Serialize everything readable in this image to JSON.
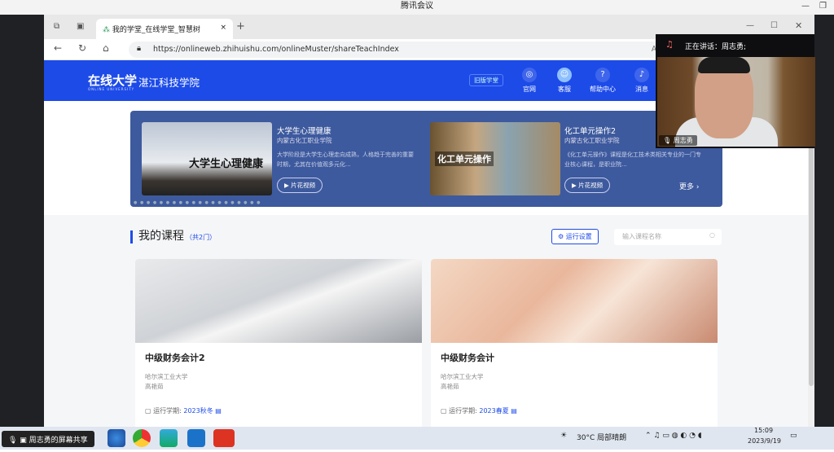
{
  "app": {
    "title": "腾讯会议"
  },
  "browser": {
    "tab_title": "我的学堂_在线学堂_智慧树",
    "tab_close": "×",
    "new_tab": "+",
    "url": "https://onlineweb.zhihuishu.com/onlineMuster/shareTeachIndex"
  },
  "header": {
    "logo": "在线大学",
    "logo_sub": "ONLINE UNIVERSITY",
    "school": "湛江科技学院",
    "old_btn": "旧版学堂",
    "nav": [
      {
        "label": "官网",
        "icon": "globe-icon"
      },
      {
        "label": "客服",
        "icon": "user-icon"
      },
      {
        "label": "帮助中心",
        "icon": "help-icon"
      },
      {
        "label": "消息",
        "icon": "bell-icon"
      }
    ]
  },
  "banner": {
    "items": [
      {
        "title": "大学生心理健康",
        "school": "内蒙古化工职业学院",
        "desc": "大学阶段是大学生心理走向成熟，人格趋于完善的重要时期，尤其在价值观多元化...",
        "btn": "▶ 片花视频",
        "img_text": "大学生心理健康"
      },
      {
        "title": "化工单元操作2",
        "school": "内蒙古化工职业学院",
        "desc": "《化工单元操作》课程是化工技术类相关专业的一门专业核心课程，是职业院...",
        "btn": "▶ 片花视频",
        "img_text": "化工单元操作"
      }
    ],
    "more": "更多 ›"
  },
  "courses": {
    "title": "我的课程",
    "count": "（共2门）",
    "settings_btn": "⚙ 运行设置",
    "search_placeholder": "输入课程名称",
    "items": [
      {
        "title": "中级财务会计2",
        "university": "哈尔滨工业大学",
        "teacher": "高艳茹",
        "term_label": "运行学期:",
        "term": "2023秋冬"
      },
      {
        "title": "中级财务会计",
        "university": "哈尔滨工业大学",
        "teacher": "高艳茹",
        "term_label": "运行学期:",
        "term": "2023春夏"
      }
    ]
  },
  "meeting": {
    "speaking": "正在讲话：周志勇;",
    "participant": "周志勇",
    "share_label": "周志勇的屏幕共享"
  },
  "taskbar": {
    "weather": "30°C 局部晴朗",
    "time": "15:09",
    "date": "2023/9/19"
  },
  "colors": {
    "accent": "#1d4be8",
    "banner": "#3e5a9e"
  }
}
